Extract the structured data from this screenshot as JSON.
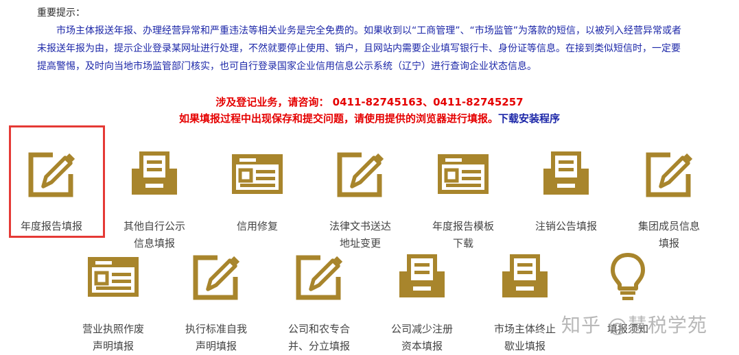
{
  "notice": {
    "title": "重要提示：",
    "body": "市场主体报送年报、办理经营异常和严重违法等相关业务是完全免费的。如果收到以“工商管理”、“市场监管”为落款的短信，以被列入经营异常或者未报送年报为由，提示企业登录某网址进行处理，不然就要停止使用、销户，且网站内需要企业填写银行卡、身份证等信息。在接到类似短信时，一定要提高警惕，及时向当地市场监管部门核实，也可自行登录国家企业信用信息公示系统（辽宁）进行查询企业状态信息。"
  },
  "contact_line": "涉及登记业务，请咨询： 0411-82745163、0411-82745257",
  "browser_notice": "如果填报过程中出现保存和提交问题，请使用提供的浏览器进行填报。",
  "download_link": "下载安装程序",
  "colors": {
    "icon_gold": "#a8852c",
    "link_blue": "#1c27a8",
    "alert_red": "#e50000",
    "highlight_red": "#e53935"
  },
  "tiles_row1": [
    {
      "icon": "pencil-square-icon",
      "label1": "年度报告填报",
      "label2": ""
    },
    {
      "icon": "inbox-tray-icon",
      "label1": "其他自行公示",
      "label2": "信息填报"
    },
    {
      "icon": "id-card-icon",
      "label1": "信用修复",
      "label2": ""
    },
    {
      "icon": "pencil-square-icon",
      "label1": "法律文书送达",
      "label2": "地址变更"
    },
    {
      "icon": "id-card-icon",
      "label1": "年度报告模板",
      "label2": "下载"
    },
    {
      "icon": "inbox-tray-icon",
      "label1": "注销公告填报",
      "label2": ""
    },
    {
      "icon": "pencil-square-icon",
      "label1": "集团成员信息",
      "label2": "填报"
    }
  ],
  "tiles_row2": [
    {
      "icon": "id-card-icon",
      "label1": "营业执照作废",
      "label2": "声明填报"
    },
    {
      "icon": "pencil-square-icon",
      "label1": "执行标准自我",
      "label2": "声明填报"
    },
    {
      "icon": "pencil-square-icon",
      "label1": "公司和农专合",
      "label2": "并、分立填报"
    },
    {
      "icon": "inbox-tray-icon",
      "label1": "公司减少注册",
      "label2": "资本填报"
    },
    {
      "icon": "inbox-tray-icon",
      "label1": "市场主体终止",
      "label2": "歇业填报"
    },
    {
      "icon": "lightbulb-icon",
      "label1": "填报须知",
      "label2": ""
    }
  ],
  "watermark": "知乎 @慧税学苑"
}
